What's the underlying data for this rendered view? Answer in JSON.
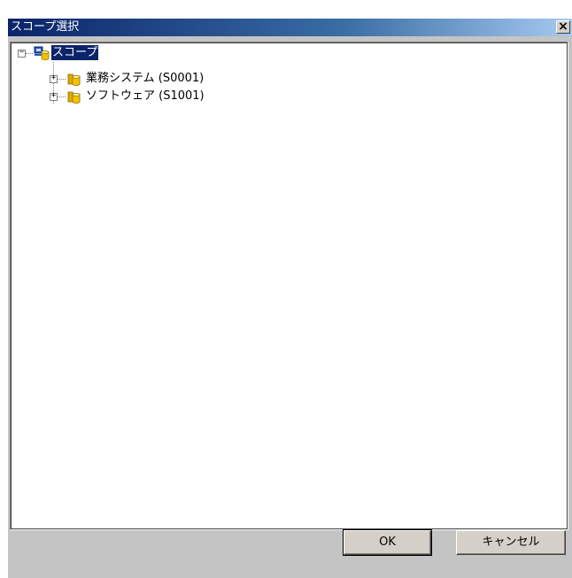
{
  "window": {
    "title": "スコープ選択",
    "close_glyph": "×"
  },
  "tree": {
    "root": {
      "label": "スコープ",
      "expander": "−",
      "icon": "scope-root-icon",
      "selected": true
    },
    "children": [
      {
        "label": "業務システム (S0001)",
        "expander": "+",
        "icon": "folder-cylinder-icon"
      },
      {
        "label": "ソフトウェア (S1001)",
        "expander": "+",
        "icon": "folder-cylinder-icon"
      }
    ]
  },
  "buttons": {
    "ok": "OK",
    "cancel": "キャンセル"
  },
  "colors": {
    "titlebar_start": "#0a246a",
    "titlebar_end": "#a6caf0",
    "selection": "#0a246a",
    "dialog_face": "#c4c4c4",
    "folder_yellow": "#f2c200"
  }
}
